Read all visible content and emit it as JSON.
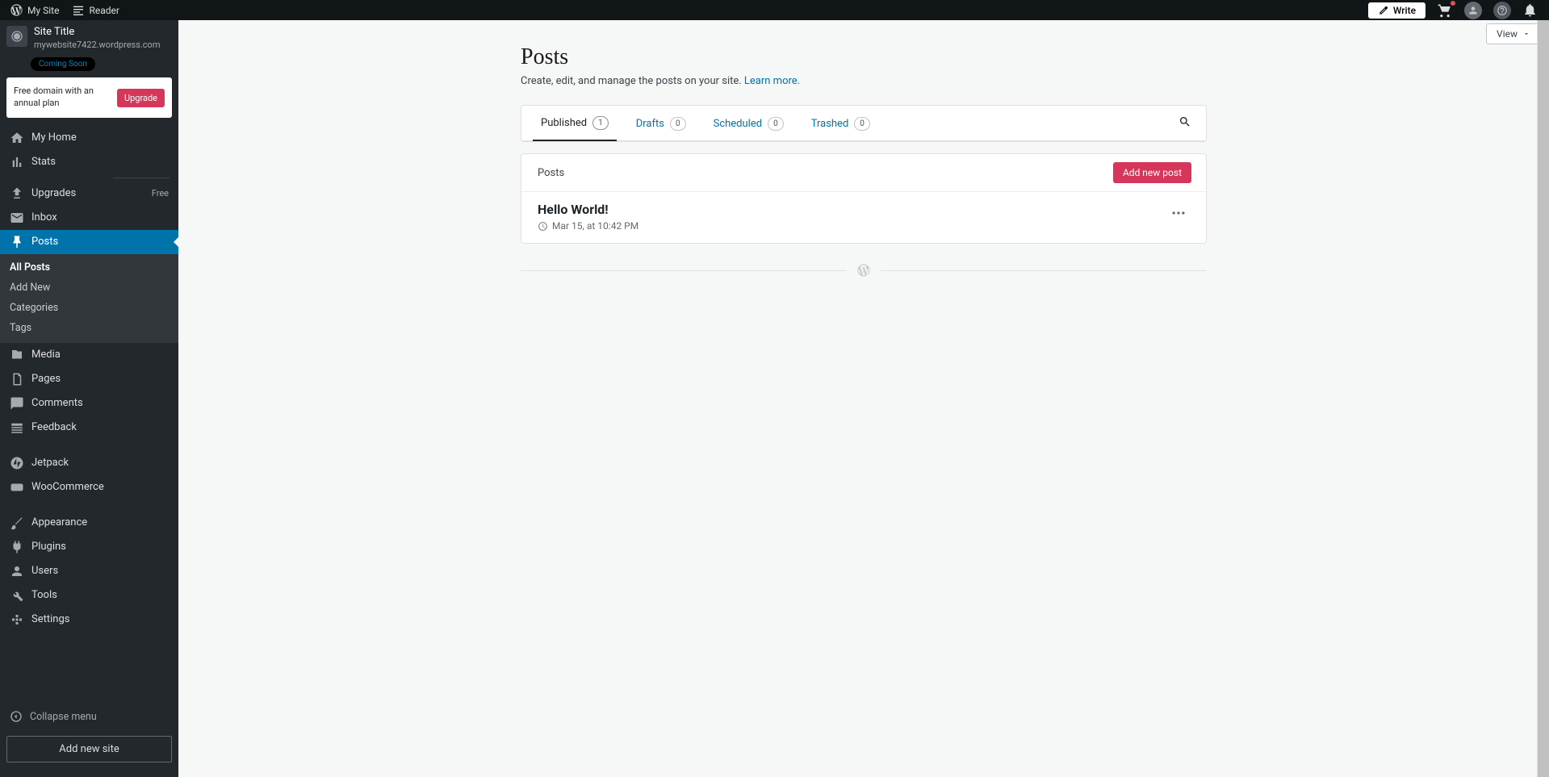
{
  "topbar": {
    "my_site": "My Site",
    "reader": "Reader",
    "write": "Write"
  },
  "site": {
    "title": "Site Title",
    "url": "mywebsite7422.wordpress.com",
    "status_badge": "Coming Soon"
  },
  "upsell": {
    "text": "Free domain with an annual plan",
    "cta": "Upgrade"
  },
  "sidebar": {
    "items": [
      {
        "label": "My Home"
      },
      {
        "label": "Stats"
      },
      {
        "label": "Upgrades",
        "pill": "Free"
      },
      {
        "label": "Inbox"
      },
      {
        "label": "Posts"
      },
      {
        "label": "Media"
      },
      {
        "label": "Pages"
      },
      {
        "label": "Comments"
      },
      {
        "label": "Feedback"
      },
      {
        "label": "Jetpack"
      },
      {
        "label": "WooCommerce"
      },
      {
        "label": "Appearance"
      },
      {
        "label": "Plugins"
      },
      {
        "label": "Users"
      },
      {
        "label": "Tools"
      },
      {
        "label": "Settings"
      }
    ],
    "sub": [
      "All Posts",
      "Add New",
      "Categories",
      "Tags"
    ],
    "collapse": "Collapse menu",
    "add_site": "Add new site"
  },
  "page": {
    "title": "Posts",
    "subtitle": "Create, edit, and manage the posts on your site. ",
    "learn_more": "Learn more",
    "view": "View"
  },
  "tabs": [
    {
      "label": "Published",
      "count": "1"
    },
    {
      "label": "Drafts",
      "count": "0"
    },
    {
      "label": "Scheduled",
      "count": "0"
    },
    {
      "label": "Trashed",
      "count": "0"
    }
  ],
  "list": {
    "header": "Posts",
    "add_btn": "Add new post",
    "posts": [
      {
        "title": "Hello World!",
        "date": "Mar 15, at 10:42 PM"
      }
    ]
  }
}
